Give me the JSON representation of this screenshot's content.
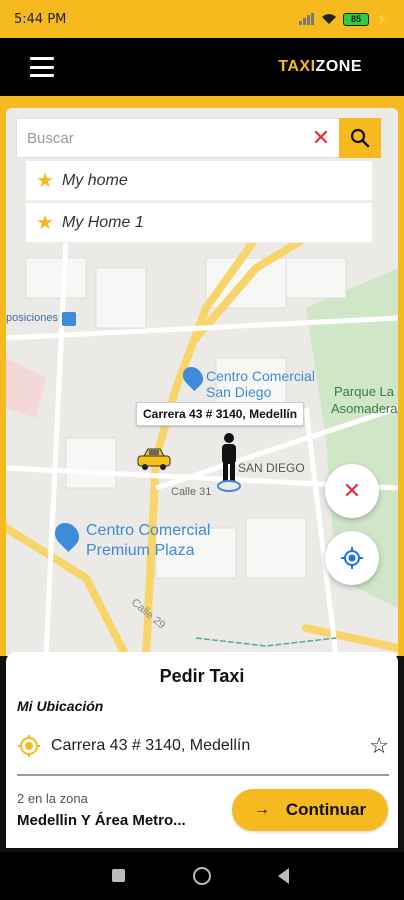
{
  "status": {
    "time": "5:44 PM",
    "battery": "85"
  },
  "header": {
    "brand_part1": "TAXI",
    "brand_part2": "ZONE"
  },
  "search": {
    "placeholder": "Buscar",
    "value": ""
  },
  "favorites": [
    {
      "label": "My home"
    },
    {
      "label": "My Home 1"
    }
  ],
  "map": {
    "labels": {
      "exposiciones": "posiciones",
      "cc_san_diego_1": "Centro Comercial",
      "cc_san_diego_2": "San Diego",
      "parque_1": "Parque La",
      "parque_2": "Asomadera",
      "san_diego": "SAN DIEGO",
      "calle31": "Calle 31",
      "cc_premium_1": "Centro Comercial",
      "cc_premium_2": "Premium Plaza",
      "calle29": "Calle 29"
    },
    "callout": "Carrera 43 # 3140, Medellín"
  },
  "sheet": {
    "title": "Pedir Taxi",
    "subtitle": "Mi Ubicación",
    "address": "Carrera 43 # 3140, Medellín",
    "zone_count": "2 en la zona",
    "zone_name": "Medellin Y Área Metro...",
    "continue_label": "Continuar"
  },
  "colors": {
    "accent": "#f6b91e",
    "danger": "#d33",
    "locate": "#1a73e8"
  }
}
